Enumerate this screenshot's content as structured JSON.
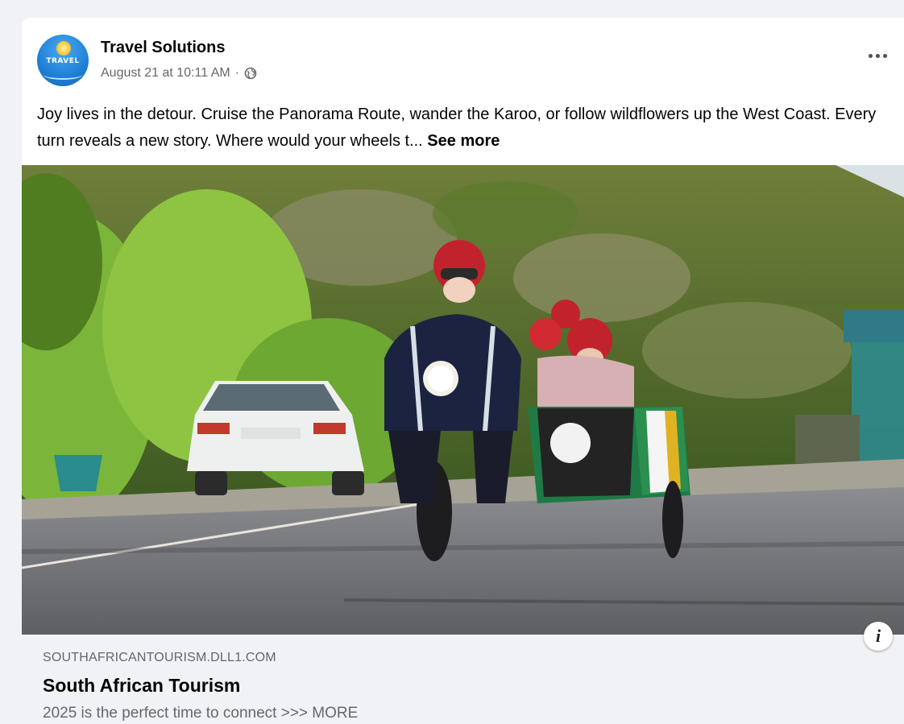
{
  "post": {
    "page_name": "Travel Solutions",
    "timestamp": "August 21 at 10:11 AM",
    "separator": "·",
    "caption": "Joy lives in the detour. Cruise the Panorama Route, wander the Karoo, or follow wildflowers up the West Coast. Every turn reveals a new story. Where would your wheels t...",
    "see_more": "See more",
    "avatar_text": "TRAVEL",
    "accent": "#1877f2"
  },
  "link_preview": {
    "domain": "SOUTHAFRICANTOURISM.DLL1.COM",
    "title": "South African Tourism",
    "description": "2025 is the perfect time to connect >>> MORE"
  },
  "icons": {
    "privacy": "globe-icon",
    "options": "more-options-icon",
    "info": "info-icon"
  }
}
